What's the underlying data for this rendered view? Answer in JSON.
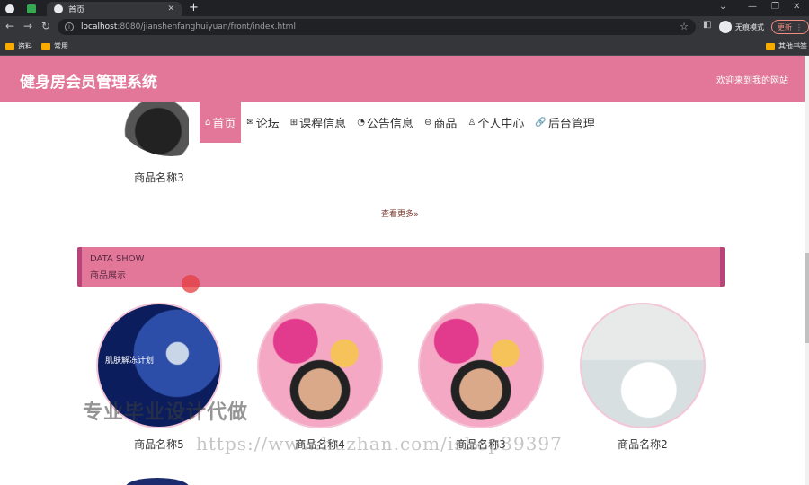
{
  "browser": {
    "tab_title": "首页",
    "url_host": "localhost",
    "url_rest": ":8080/jianshenfanghuiyuan/front/index.html",
    "incognito_label": "无痕模式",
    "update_label": "更新",
    "bookmarks": [
      "资料",
      "常用"
    ],
    "other_bookmarks": "其他书签"
  },
  "header": {
    "title": "健身房会员管理系统",
    "welcome": "欢迎来到我的网站"
  },
  "nav": {
    "items": [
      {
        "icon": "⌂",
        "label": "首页"
      },
      {
        "icon": "✉",
        "label": "论坛"
      },
      {
        "icon": "⊞",
        "label": "课程信息"
      },
      {
        "icon": "◔",
        "label": "公告信息"
      },
      {
        "icon": "⊖",
        "label": "商品"
      },
      {
        "icon": "♙",
        "label": "个人中心"
      },
      {
        "icon": "🔗",
        "label": "后台管理"
      }
    ]
  },
  "section_top": {
    "product_name": "商品名称3",
    "more_link": "查看更多»"
  },
  "data_show": {
    "en": "DATA SHOW",
    "cn": "商品展示"
  },
  "products": [
    {
      "name": "商品名称5",
      "img_text": "肌肤解冻计划"
    },
    {
      "name": "商品名称4"
    },
    {
      "name": "商品名称3"
    },
    {
      "name": "商品名称2"
    }
  ],
  "watermark": {
    "cn": "专业毕业设计代做",
    "url": "https://www.huzhan.com/ishop39397"
  }
}
